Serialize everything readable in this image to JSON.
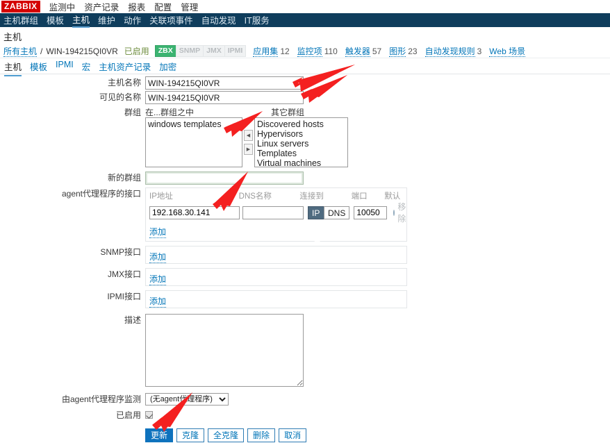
{
  "topmenu": {
    "logo": "ZABBIX",
    "items": [
      "监测中",
      "资产记录",
      "报表",
      "配置",
      "管理"
    ],
    "active": "配置"
  },
  "navmenu": {
    "items": [
      "主机群组",
      "模板",
      "主机",
      "维护",
      "动作",
      "关联项事件",
      "自动发现",
      "IT服务"
    ],
    "active": "主机"
  },
  "page": {
    "title": "主机"
  },
  "breadcrumb": {
    "all_hosts": "所有主机",
    "separator": "/",
    "host": "WIN-194215QI0VR",
    "status": "已启用",
    "tags": [
      {
        "label": "ZBX",
        "enabled": true
      },
      {
        "label": "SNMP",
        "enabled": false
      },
      {
        "label": "JMX",
        "enabled": false
      },
      {
        "label": "IPMI",
        "enabled": false
      }
    ],
    "links": [
      {
        "label": "应用集",
        "count": "12"
      },
      {
        "label": "监控项",
        "count": "110"
      },
      {
        "label": "触发器",
        "count": "57"
      },
      {
        "label": "图形",
        "count": "23"
      },
      {
        "label": "自动发现规则",
        "count": "3"
      },
      {
        "label": "Web 场景",
        "count": ""
      }
    ]
  },
  "tabs": {
    "items": [
      "主机",
      "模板",
      "IPMI",
      "宏",
      "主机资产记录",
      "加密"
    ],
    "active": "主机"
  },
  "form": {
    "host_name": {
      "label": "主机名称",
      "value": "WIN-194215QI0VR"
    },
    "visible_name": {
      "label": "可见的名称",
      "value": "WIN-194215QI0VR"
    },
    "groups": {
      "label": "群组",
      "in_groups_header": "在...群组之中",
      "other_groups_header": "其它群组",
      "in_groups": [
        "windows templates"
      ],
      "other_groups": [
        "Discovered hosts",
        "Hypervisors",
        "Linux servers",
        "Templates",
        "Virtual machines"
      ],
      "move_left_icon": "triangle-left-icon",
      "move_right_icon": "triangle-right-icon"
    },
    "new_group": {
      "label": "新的群组",
      "value": "",
      "placeholder": ""
    },
    "agent_interfaces": {
      "label": "agent代理程序的接口",
      "headers": {
        "ip": "IP地址",
        "dns": "DNS名称",
        "connect_to": "连接到",
        "port": "端口",
        "default": "默认"
      },
      "rows": [
        {
          "ip": "192.168.30.141",
          "dns": "",
          "connect_options": [
            "IP地址",
            "DNS"
          ],
          "connect_selected": "IP地址",
          "port": "10050",
          "remove_label": "移除"
        }
      ],
      "add_label": "添加"
    },
    "snmp_interfaces": {
      "label": "SNMP接口",
      "add_label": "添加"
    },
    "jmx_interfaces": {
      "label": "JMX接口",
      "add_label": "添加"
    },
    "ipmi_interfaces": {
      "label": "IPMI接口",
      "add_label": "添加"
    },
    "description": {
      "label": "描述",
      "value": ""
    },
    "monitored_by_proxy": {
      "label": "由agent代理程序监测",
      "selected": "(无agent代理程序)",
      "options": [
        "(无agent代理程序)"
      ]
    },
    "enabled": {
      "label": "已启用",
      "checked": true
    }
  },
  "buttons": {
    "update": "更新",
    "clone": "克隆",
    "full_clone": "全克隆",
    "delete": "删除",
    "cancel": "取消"
  },
  "colors": {
    "logo_red": "#d40000",
    "nav_bg": "#0f3d5c",
    "link_blue": "#0275b8",
    "primary_button": "#0e72bd",
    "tag_on_green": "#3bb371",
    "annotation_red": "#f42020",
    "status_green": "#6c8c3c"
  }
}
